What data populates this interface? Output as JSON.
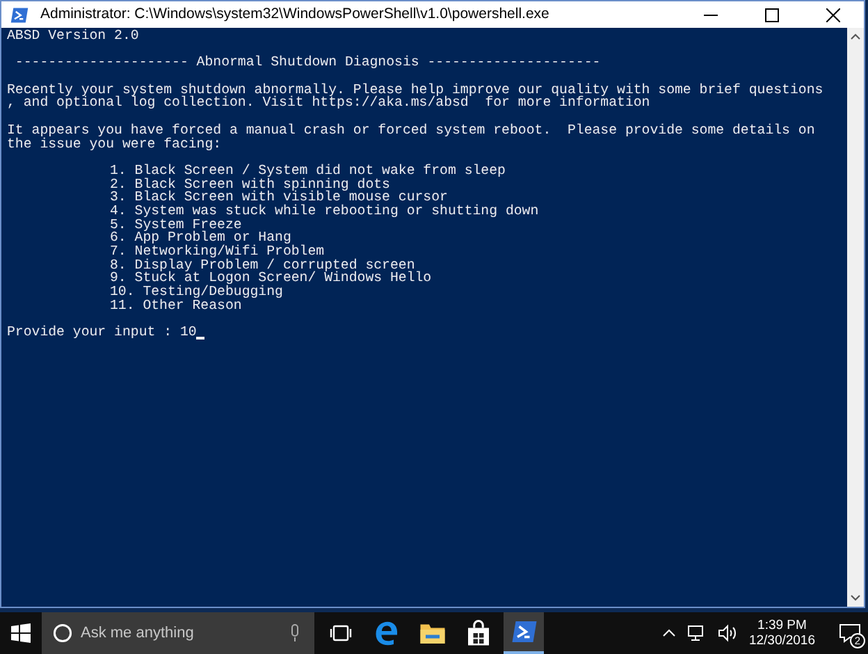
{
  "window": {
    "title": "Administrator: C:\\Windows\\system32\\WindowsPowerShell\\v1.0\\powershell.exe"
  },
  "console": {
    "version": "ABSD Version 2.0",
    "banner": " --------------------- Abnormal Shutdown Diagnosis ---------------------",
    "paragraphs": [
      [
        "Recently your system shutdown abnormally. Please help improve our quality with some brief questions",
        ", and optional log collection. Visit https://aka.ms/absd  for more information"
      ],
      [
        "It appears you have forced a manual crash or forced system reboot.  Please provide some details on",
        "the issue you were facing:"
      ]
    ],
    "options": [
      "1. Black Screen / System did not wake from sleep",
      "2. Black Screen with spinning dots",
      "3. Black Screen with visible mouse cursor",
      "4. System was stuck while rebooting or shutting down",
      "5. System Freeze",
      "6. App Problem or Hang",
      "7. Networking/Wifi Problem",
      "8. Display Problem / corrupted screen",
      "9. Stuck at Logon Screen/ Windows Hello",
      "10. Testing/Debugging",
      "11. Other Reason"
    ],
    "prompt": {
      "label": "Provide your input : ",
      "value": "10"
    }
  },
  "taskbar": {
    "search": {
      "placeholder": "Ask me anything"
    },
    "apps": [
      {
        "kind": "taskview",
        "selected": false
      },
      {
        "kind": "edge",
        "selected": false
      },
      {
        "kind": "explorer",
        "selected": false
      },
      {
        "kind": "store",
        "selected": false
      },
      {
        "kind": "powershell",
        "selected": true
      }
    ],
    "time": "1:39 PM",
    "date": "12/30/2016",
    "notifications": "2"
  }
}
